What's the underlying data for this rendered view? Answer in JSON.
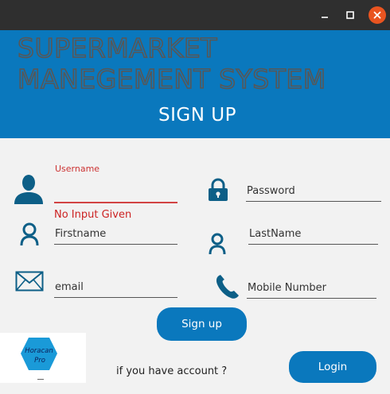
{
  "window": {
    "controls": {
      "minimize": "minimize",
      "maximize": "maximize",
      "close": "close"
    }
  },
  "header": {
    "app_title": "SUPERMARKET\nMANEGEMENT SYSTEM",
    "page_title": "SIGN UP"
  },
  "form": {
    "username": {
      "floating_label": "Username",
      "value": "",
      "error": "No Input Given",
      "icon": "user-silhouette-icon"
    },
    "password": {
      "placeholder": "Password",
      "value": "",
      "icon": "padlock-icon"
    },
    "firstname": {
      "placeholder": "Firstname",
      "value": "",
      "icon": "person-outline-icon"
    },
    "lastname": {
      "placeholder": "LastName",
      "value": "",
      "icon": "person-outline-icon"
    },
    "email": {
      "placeholder": "email",
      "value": "",
      "icon": "envelope-icon"
    },
    "mobile": {
      "placeholder": "Mobile Number",
      "value": "",
      "icon": "phone-icon"
    }
  },
  "actions": {
    "signup_label": "Sign up",
    "account_prompt": "if you have account ?",
    "login_label": "Login"
  },
  "logo": {
    "line1": "Horacan",
    "line2": "Pro"
  },
  "colors": {
    "accent": "#0a78bd",
    "titlebar": "#2f2f2f",
    "background": "#f2f2f2",
    "error": "#cc2222",
    "close_button": "#e95420",
    "icon": "#0d5f87"
  }
}
